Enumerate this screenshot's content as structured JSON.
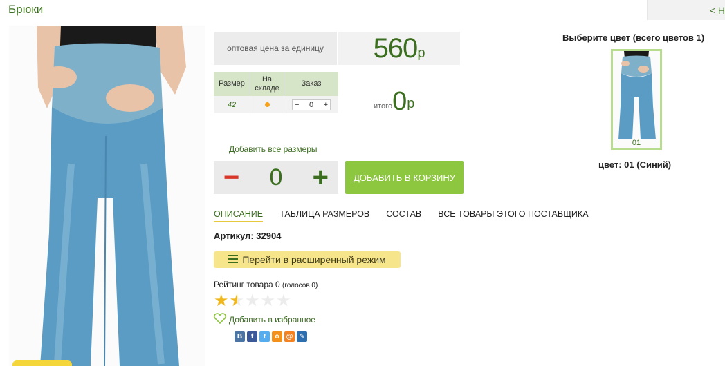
{
  "header": {
    "title": "Брюки",
    "back_label": "< Н"
  },
  "price": {
    "label": "оптовая цена за единицу",
    "value": "560",
    "currency": "р"
  },
  "size_table": {
    "headers": [
      "Размер",
      "На складе",
      "Заказ"
    ],
    "rows": [
      {
        "size": "42",
        "qty": "0"
      }
    ]
  },
  "total": {
    "label": "итого",
    "value": "0",
    "currency": "р"
  },
  "add_all_label": "Добавить все размеры",
  "stepper": {
    "minus": "−",
    "value": "0",
    "plus": "+"
  },
  "cart_button": "ДОБАВИТЬ В КОРЗИНУ",
  "tabs": [
    "ОПИСАНИЕ",
    "ТАБЛИЦА РАЗМЕРОВ",
    "СОСТАВ",
    "ВСЕ ТОВАРЫ ЭТОГО ПОСТАВЩИКА"
  ],
  "article": "Артикул: 32904",
  "advanced_button": "Перейти в расширенный режим",
  "rating": {
    "text": "Рейтинг товара 0",
    "votes": "(голосов 0)",
    "stars": 1.5,
    "max": 5
  },
  "favorite_label": "Добавить в избранное",
  "social": [
    {
      "name": "vk-icon",
      "glyph": "В",
      "color": "#4c75a3"
    },
    {
      "name": "facebook-icon",
      "glyph": "f",
      "color": "#3b5998"
    },
    {
      "name": "twitter-icon",
      "glyph": "t",
      "color": "#55acee"
    },
    {
      "name": "odnoklassniki-icon",
      "glyph": "о",
      "color": "#f2911b"
    },
    {
      "name": "mailru-icon",
      "glyph": "@",
      "color": "#f58220"
    },
    {
      "name": "livejournal-icon",
      "glyph": "✎",
      "color": "#2d6eae"
    }
  ],
  "color_picker": {
    "title": "Выберите цвет (всего цветов 1)",
    "swatch_label": "01",
    "selected": "цвет: 01 (Синий)"
  },
  "colors": {
    "accent": "#3b6e1f",
    "button": "#8dc63f",
    "highlight": "#f7e58c"
  }
}
